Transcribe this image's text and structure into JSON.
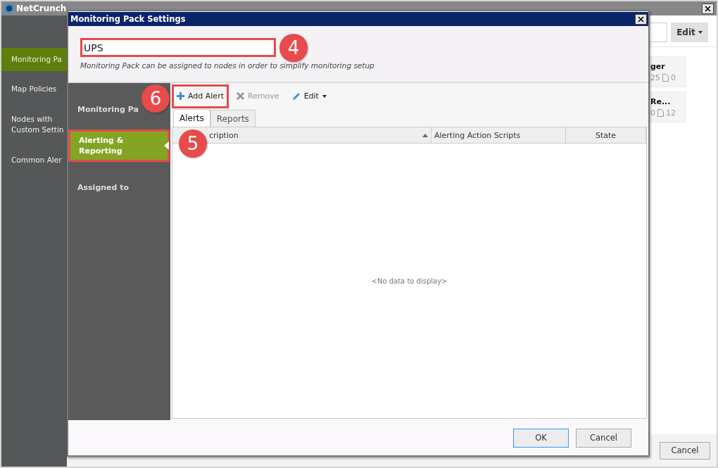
{
  "app_window": {
    "title": "NetCrunch",
    "sidebar": [
      {
        "label": "Monitoring Pa",
        "selected": true
      },
      {
        "label": "Map Policies",
        "selected": false
      },
      {
        "label": "Nodes with Custom Settin",
        "selected": false
      },
      {
        "label": "Common Aler",
        "selected": false
      }
    ],
    "edit_menu": "Edit",
    "cards": [
      {
        "title": "ger",
        "count_1": "25",
        "count_2": "0"
      },
      {
        "title": "Re...",
        "count_1": "0",
        "count_2": "12"
      }
    ],
    "buttons": [
      "Cancel"
    ]
  },
  "dialog": {
    "title": "Monitoring Pack Settings",
    "name_field": {
      "value": "UPS",
      "highlighted": true
    },
    "description": "Monitoring Pack can be assigned to nodes in order to simplify monitoring setup",
    "nav": [
      {
        "label": "Monitoring Pa",
        "selected": false,
        "highlighted": false
      },
      {
        "label": "Alerting & Reporting",
        "selected": true,
        "highlighted": true
      },
      {
        "label": "Assigned to",
        "selected": false,
        "highlighted": false
      }
    ],
    "toolbar": [
      {
        "label": "Add Alert",
        "kind": "add",
        "disabled": false,
        "highlighted": true
      },
      {
        "label": "Remove",
        "kind": "remove",
        "disabled": true,
        "highlighted": false
      },
      {
        "label": "Edit",
        "kind": "edit",
        "disabled": false,
        "highlighted": false
      }
    ],
    "tabs": [
      {
        "label": "Alerts",
        "selected": true
      },
      {
        "label": "Reports",
        "selected": false
      }
    ],
    "table": {
      "columns": [
        "cription",
        "Alerting Action Scripts",
        "State"
      ],
      "empty_text": "<No data to display>"
    },
    "buttons": [
      "OK",
      "Cancel"
    ],
    "callouts": [
      "4",
      "5",
      "6"
    ]
  }
}
